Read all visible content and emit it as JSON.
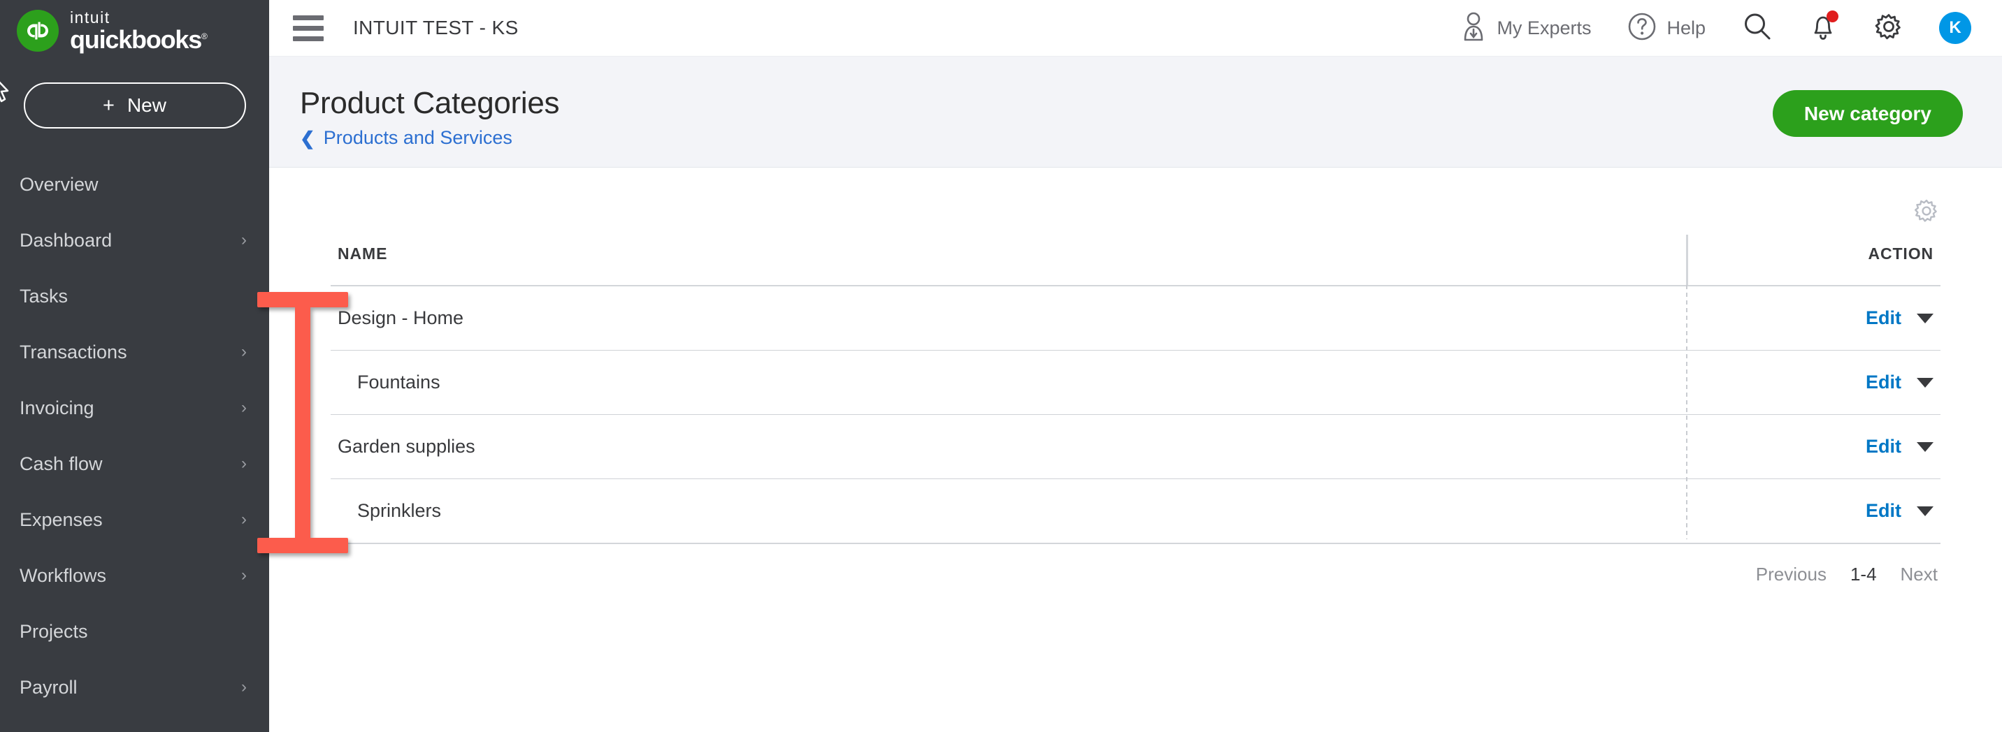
{
  "brand": {
    "intuit": "intuit",
    "quickbooks": "quickbooks",
    "registered": "®"
  },
  "sidebar": {
    "new_button": {
      "plus": "+",
      "label": "New"
    },
    "items": [
      {
        "label": "Overview",
        "has_chevron": false
      },
      {
        "label": "Dashboard",
        "has_chevron": true
      },
      {
        "label": "Tasks",
        "has_chevron": false
      },
      {
        "label": "Transactions",
        "has_chevron": true
      },
      {
        "label": "Invoicing",
        "has_chevron": true
      },
      {
        "label": "Cash flow",
        "has_chevron": true
      },
      {
        "label": "Expenses",
        "has_chevron": true
      },
      {
        "label": "Workflows",
        "has_chevron": true
      },
      {
        "label": "Projects",
        "has_chevron": false
      },
      {
        "label": "Payroll",
        "has_chevron": true
      }
    ],
    "chevron_glyph": "›",
    "background_color": "#393c41"
  },
  "topbar": {
    "company": "INTUIT TEST - KS",
    "my_experts": "My Experts",
    "help": "Help",
    "avatar_initial": "K",
    "avatar_color": "#0097e6",
    "notification_dot_color": "#e01e1e"
  },
  "page_header": {
    "title": "Product Categories",
    "breadcrumb_chevron": "❮",
    "breadcrumb": "Products and Services",
    "new_category_button": "New category",
    "button_color": "#2ca01c",
    "link_color": "#2c6fd1",
    "background_color": "#f3f4f8"
  },
  "table": {
    "columns": {
      "name": "NAME",
      "action": "ACTION"
    },
    "rows": [
      {
        "name": "Design - Home",
        "indented": false,
        "action": "Edit"
      },
      {
        "name": "Fountains",
        "indented": true,
        "action": "Edit"
      },
      {
        "name": "Garden supplies",
        "indented": false,
        "action": "Edit"
      },
      {
        "name": "Sprinklers",
        "indented": true,
        "action": "Edit"
      }
    ],
    "action_link_color": "#0077c5"
  },
  "pagination": {
    "previous": "Previous",
    "range": "1-4",
    "next": "Next"
  },
  "cursor": {
    "type": "i-beam-text-cursor",
    "color": "#fc5c4c"
  }
}
